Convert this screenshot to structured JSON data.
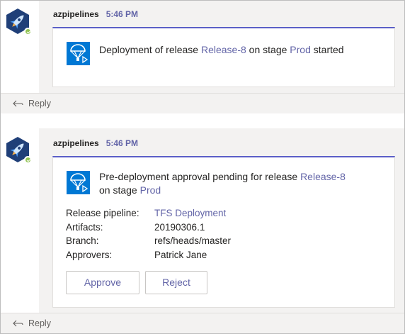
{
  "messages": [
    {
      "sender": "azpipelines",
      "time": "5:46 PM",
      "title_prefix": "Deployment of release ",
      "release": "Release-8",
      "title_mid": " on stage ",
      "stage": "Prod",
      "title_suffix": " started",
      "reply_label": "Reply"
    },
    {
      "sender": "azpipelines",
      "time": "5:46 PM",
      "title_prefix": "Pre-deployment approval pending for release ",
      "release": "Release-8",
      "title_line2_prefix": "on stage ",
      "stage": "Prod",
      "facts": [
        {
          "label": "Release pipeline:",
          "value": "TFS Deployment"
        },
        {
          "label": "Artifacts:",
          "value": "20190306.1"
        },
        {
          "label": "Branch:",
          "value": "refs/heads/master"
        },
        {
          "label": "Approvers:",
          "value": "Patrick Jane"
        }
      ],
      "approve_label": "Approve",
      "reject_label": "Reject",
      "reply_label": "Reply"
    }
  ],
  "icons": {
    "avatar": "azure-pipelines-rocket-icon",
    "card": "release-parachute-icon",
    "presence": "available-check-icon",
    "reply": "reply-arrow-icon"
  },
  "colors": {
    "accent": "#6264a7",
    "card_icon_bg": "#0078d4",
    "avatar_bg": "#1f3f78",
    "presence": "#92c353"
  }
}
